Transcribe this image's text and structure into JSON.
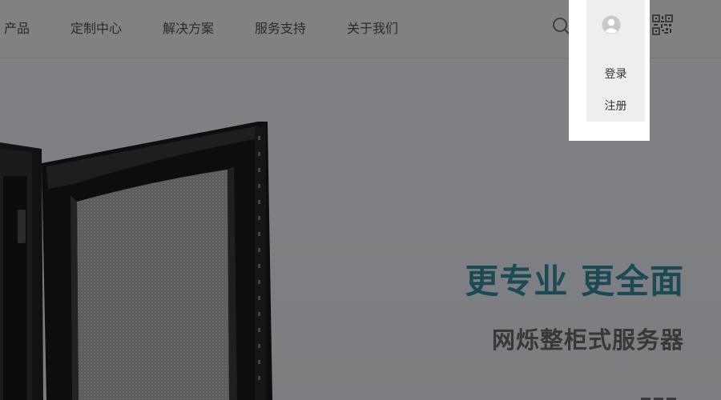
{
  "nav": {
    "items": [
      {
        "label": "产品"
      },
      {
        "label": "定制中心"
      },
      {
        "label": "解决方案"
      },
      {
        "label": "服务支持"
      },
      {
        "label": "关于我们"
      }
    ]
  },
  "header": {
    "search_icon": "search-icon",
    "qr_icon": "qr-code-icon",
    "avatar_icon": "user-avatar-icon"
  },
  "user_menu": {
    "login": "登录",
    "register": "注册"
  },
  "hero": {
    "headline": "更专业 更全面",
    "subline": "网烁整柜式服务器"
  },
  "colors": {
    "headline": "#1b4a55",
    "subline": "#383838",
    "overlay": "#7f8083",
    "panel": "#ffffff",
    "panel_inner": "#edeef0"
  }
}
